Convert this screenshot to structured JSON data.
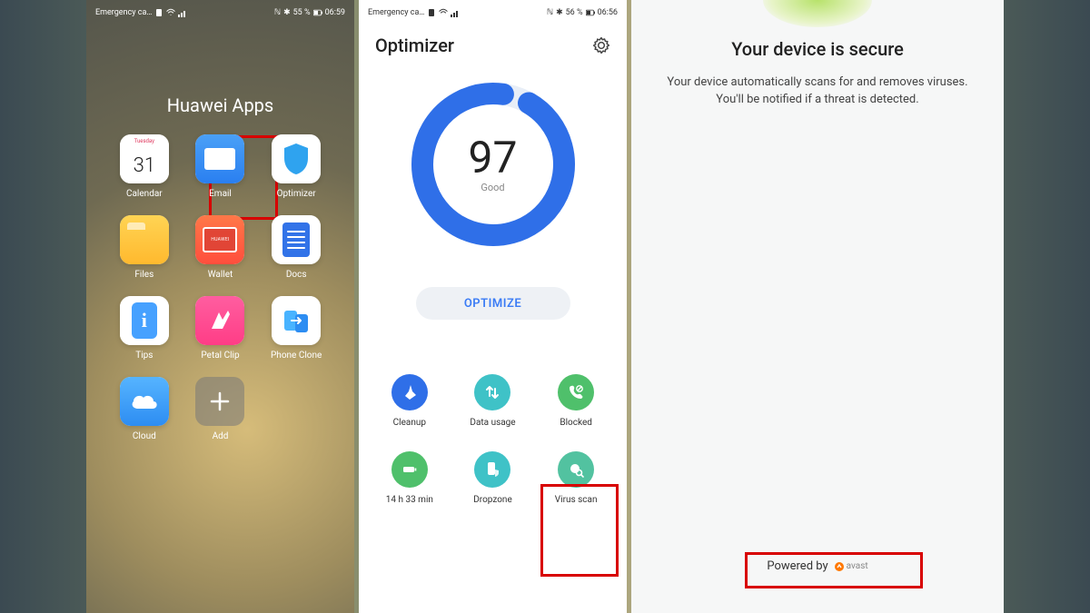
{
  "panel1": {
    "statusbar": {
      "carrier": "Emergency ca…",
      "battery": "55 %",
      "time": "06:59"
    },
    "folder_title": "Huawei Apps",
    "apps": [
      {
        "label": "Calendar",
        "day_word": "Tuesday",
        "day_num": "31",
        "kind": "calendar"
      },
      {
        "label": "Email",
        "kind": "email"
      },
      {
        "label": "Optimizer",
        "kind": "optimizer",
        "highlighted": true
      },
      {
        "label": "Files",
        "kind": "files"
      },
      {
        "label": "Wallet",
        "kind": "wallet",
        "badge": "HUAWEI"
      },
      {
        "label": "Docs",
        "kind": "docs"
      },
      {
        "label": "Tips",
        "kind": "tips"
      },
      {
        "label": "Petal Clip",
        "kind": "petal"
      },
      {
        "label": "Phone Clone",
        "kind": "clone"
      },
      {
        "label": "Cloud",
        "kind": "cloud"
      },
      {
        "label": "Add",
        "kind": "add"
      }
    ]
  },
  "panel2": {
    "statusbar": {
      "carrier": "Emergency ca…",
      "battery": "56 %",
      "time": "06:56"
    },
    "title": "Optimizer",
    "score": "97",
    "score_word": "Good",
    "optimize_button": "OPTIMIZE",
    "tools": [
      {
        "label": "Cleanup",
        "color": "#2f6fe8",
        "icon": "broom"
      },
      {
        "label": "Data usage",
        "color": "#3fc2c7",
        "icon": "arrows"
      },
      {
        "label": "Blocked",
        "color": "#4fc06b",
        "icon": "phone-block"
      },
      {
        "label": "14 h 33 min",
        "color": "#4fc06b",
        "icon": "battery"
      },
      {
        "label": "Dropzone",
        "color": "#3fc2c7",
        "icon": "phone-shield"
      },
      {
        "label": "Virus scan",
        "color": "#52c2a0",
        "icon": "virus",
        "highlighted": true
      }
    ]
  },
  "panel3": {
    "title": "Your device is secure",
    "subtitle": "Your device automatically scans for and removes viruses. You'll be notified if a threat is detected.",
    "powered_by": "Powered by",
    "vendor": "avast"
  },
  "colors": {
    "highlight": "#d80000",
    "ring": "#2f6fe8",
    "optimize_text": "#3b7cf5"
  },
  "nfc_glyph": "ℕ",
  "bt_glyph": "✱"
}
